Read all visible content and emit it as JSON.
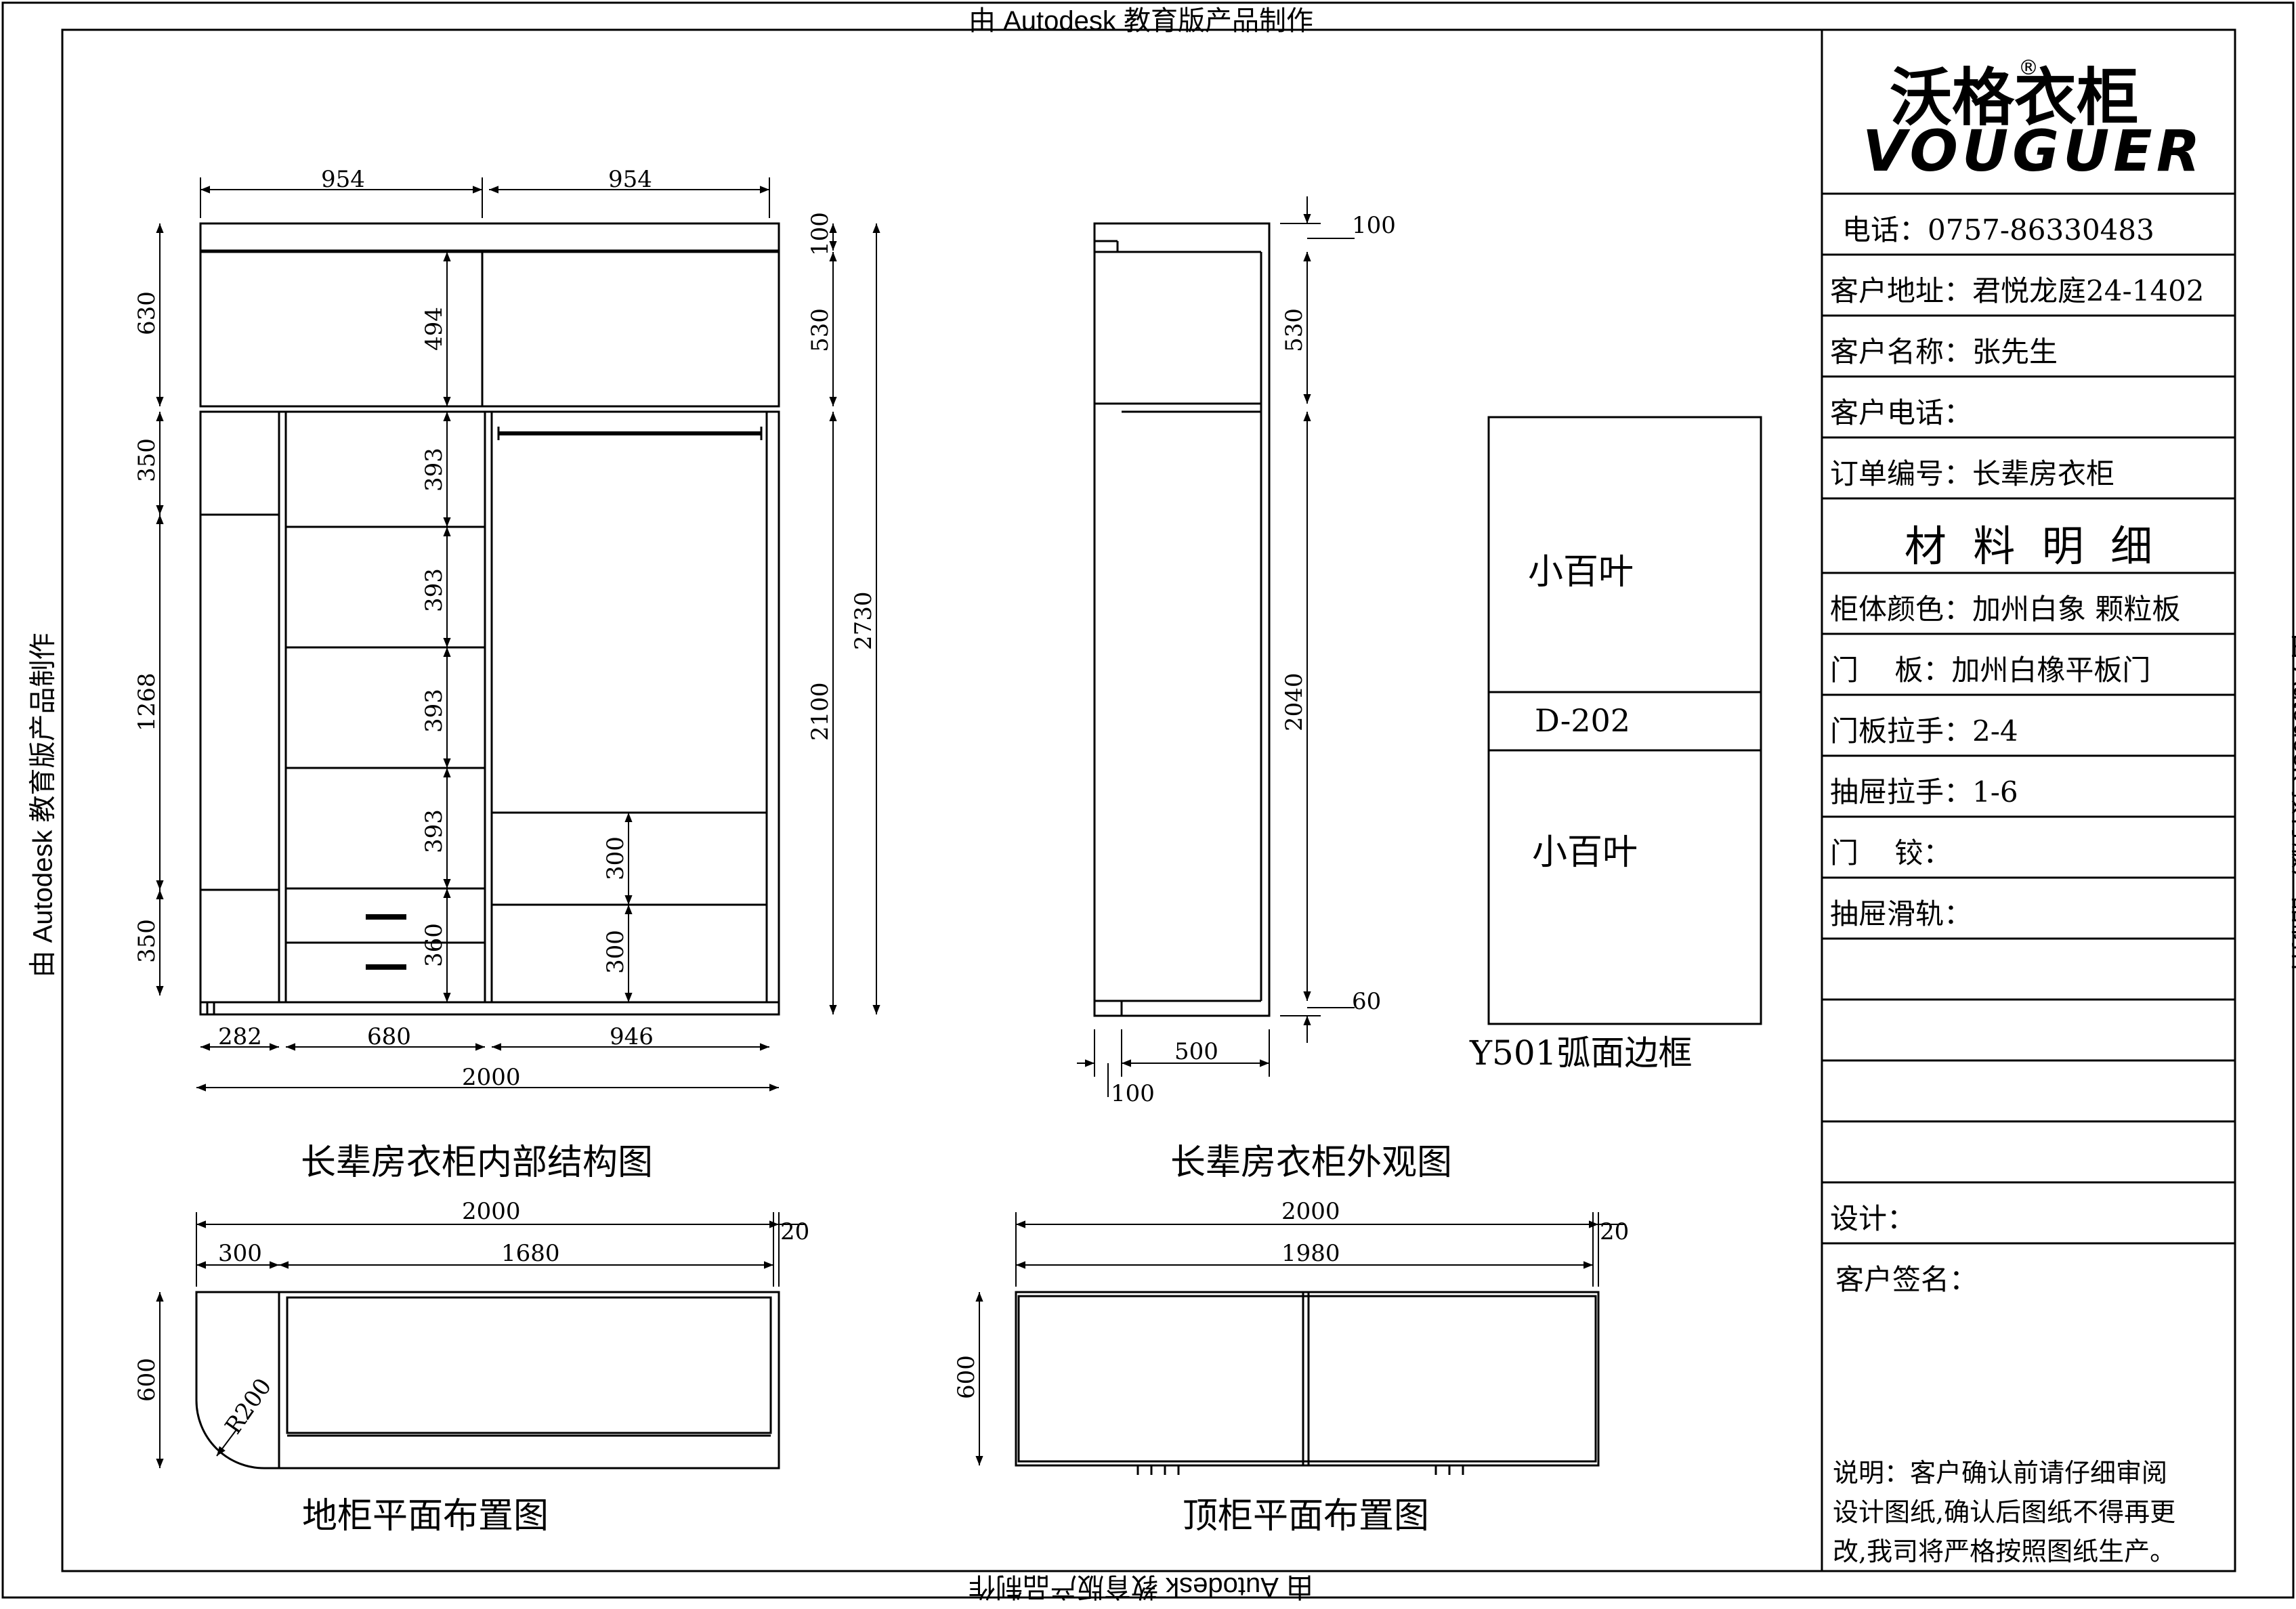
{
  "watermark": "由 Autodesk 教育版产品制作",
  "brand": {
    "name_cn": "沃格衣柜",
    "registered": "®",
    "name_en": "VOUGUER"
  },
  "title_block": {
    "rows": [
      "电话：0757-86330483",
      "客户地址：君悦龙庭24-1402",
      "客户名称：张先生",
      "客户电话：",
      "订单编号：长辈房衣柜",
      "材  料  明  细",
      "柜体颜色：加州白象 颗粒板",
      "门    板：加州白橡平板门",
      "门板拉手：2-4",
      "抽屉拉手：1-6",
      "门    铰：",
      "抽屉滑轨：",
      "",
      "",
      "",
      "",
      "设计：",
      "客户签名："
    ],
    "note_lines": [
      "说明：客户确认前请仔细审阅",
      "设计图纸,确认后图纸不得再更",
      "改,我司将严格按照图纸生产。"
    ]
  },
  "drawings": {
    "interior": {
      "title": "长辈房衣柜内部结构图",
      "dims": {
        "top_left": "954",
        "top_right": "954",
        "left_630": "630",
        "left_350a": "350",
        "left_1268": "1268",
        "left_350b": "350",
        "inner_494": "494",
        "inner_393": "393",
        "inner_360": "360",
        "inner_300": "300",
        "right_100": "100",
        "right_530": "530",
        "right_2100": "2100",
        "overall_2730": "2730",
        "bot_282": "282",
        "bot_680": "680",
        "bot_946": "946",
        "bot_2000": "2000"
      }
    },
    "exterior": {
      "title": "长辈房衣柜外观图",
      "dims": {
        "d100": "100",
        "d530": "530",
        "d2040": "2040",
        "d60": "60",
        "d500": "500",
        "d100b": "100"
      }
    },
    "door_panel": {
      "label_top": "小百叶",
      "label_mid": "D-202",
      "label_bottom": "小百叶",
      "caption": "Y501弧面边框"
    },
    "base_plan": {
      "title": "地柜平面布置图",
      "dims": {
        "w2000": "2000",
        "w20": "20",
        "w300": "300",
        "w1680": "1680",
        "d600": "600",
        "radius": "R200"
      }
    },
    "top_plan": {
      "title": "顶柜平面布置图",
      "dims": {
        "w2000": "2000",
        "w20": "20",
        "w1980": "1980",
        "d600": "600"
      }
    }
  }
}
